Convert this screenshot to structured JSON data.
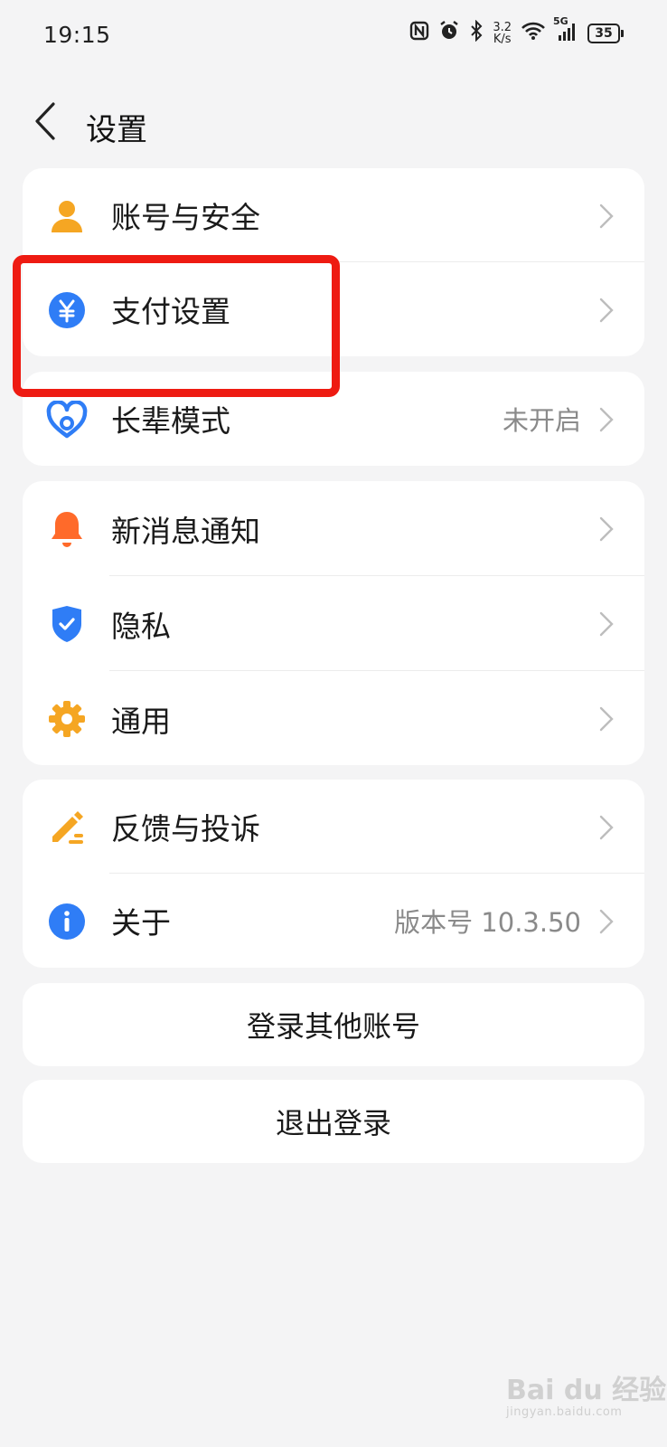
{
  "status_bar": {
    "time": "19:15",
    "net_speed_top": "3.2",
    "net_speed_bottom": "K/s",
    "network": "5G",
    "battery": "35"
  },
  "header": {
    "title": "设置"
  },
  "groups": {
    "account": {
      "items": [
        {
          "label": "账号与安全",
          "icon": "person-icon",
          "color": "#f5a623"
        },
        {
          "label": "支付设置",
          "icon": "yuan-icon",
          "color": "#2f7df6"
        }
      ]
    },
    "elder": {
      "items": [
        {
          "label": "长辈模式",
          "value": "未开启",
          "icon": "heart-icon",
          "color": "#2f7df6"
        }
      ]
    },
    "general": {
      "items": [
        {
          "label": "新消息通知",
          "icon": "bell-icon",
          "color": "#ff6a2a"
        },
        {
          "label": "隐私",
          "icon": "shield-icon",
          "color": "#2f7df6"
        },
        {
          "label": "通用",
          "icon": "gear-icon",
          "color": "#f5a623"
        }
      ]
    },
    "about": {
      "items": [
        {
          "label": "反馈与投诉",
          "icon": "pencil-icon",
          "color": "#f5a623"
        },
        {
          "label": "关于",
          "value": "版本号 10.3.50",
          "icon": "info-icon",
          "color": "#2f7df6"
        }
      ]
    }
  },
  "buttons": {
    "switch_account": "登录其他账号",
    "logout": "退出登录"
  },
  "watermark": {
    "main": "Bai du 经验",
    "sub": "jingyan.baidu.com"
  }
}
